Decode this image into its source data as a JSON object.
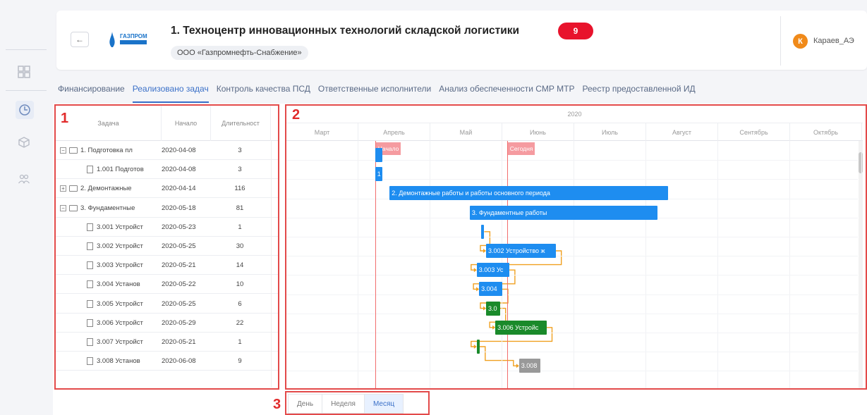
{
  "header": {
    "back_label": "←",
    "logo_text": "ГАЗПРОМ",
    "title": "1. Техноцентр инновационных технологий складской логистики",
    "badge_count": "9",
    "org": "ООО «Газпромнефть-Снабжение»",
    "avatar_letter": "К",
    "username": "Караев_АЭ"
  },
  "tabs": [
    {
      "label": "Финансирование",
      "active": false
    },
    {
      "label": "Реализовано задач",
      "active": true
    },
    {
      "label": "Контроль качества ПСД",
      "active": false
    },
    {
      "label": "Ответственные исполнители",
      "active": false
    },
    {
      "label": "Анализ обеспеченности СМР МТР",
      "active": false
    },
    {
      "label": "Реестр предоставленной ИД",
      "active": false
    }
  ],
  "grid": {
    "columns": [
      "Задача",
      "Начало",
      "Длительност"
    ],
    "rows": [
      {
        "level": 0,
        "kind": "folder-open",
        "toggle": "−",
        "task": "1. Подготовка пл",
        "start": "2020-04-08",
        "duration": "3"
      },
      {
        "level": 1,
        "kind": "file",
        "task": "1.001 Подготов",
        "start": "2020-04-08",
        "duration": "3"
      },
      {
        "level": 0,
        "kind": "folder",
        "toggle": "+",
        "task": "2. Демонтажные",
        "start": "2020-04-14",
        "duration": "116"
      },
      {
        "level": 0,
        "kind": "folder-open",
        "toggle": "−",
        "task": "3. Фундаментные",
        "start": "2020-05-18",
        "duration": "81"
      },
      {
        "level": 1,
        "kind": "file",
        "task": "3.001 Устройст",
        "start": "2020-05-23",
        "duration": "1"
      },
      {
        "level": 1,
        "kind": "file",
        "task": "3.002 Устройст",
        "start": "2020-05-25",
        "duration": "30"
      },
      {
        "level": 1,
        "kind": "file",
        "task": "3.003 Устройст",
        "start": "2020-05-21",
        "duration": "14"
      },
      {
        "level": 1,
        "kind": "file",
        "task": "3.004 Установ",
        "start": "2020-05-22",
        "duration": "10"
      },
      {
        "level": 1,
        "kind": "file",
        "task": "3.005 Устройст",
        "start": "2020-05-25",
        "duration": "6"
      },
      {
        "level": 1,
        "kind": "file",
        "task": "3.006 Устройст",
        "start": "2020-05-29",
        "duration": "22"
      },
      {
        "level": 1,
        "kind": "file",
        "task": "3.007 Устройст",
        "start": "2020-05-21",
        "duration": "1"
      },
      {
        "level": 1,
        "kind": "file",
        "task": "3.008 Установ",
        "start": "2020-06-08",
        "duration": "9"
      }
    ]
  },
  "gantt": {
    "year": "2020",
    "months": [
      "Март",
      "Апрель",
      "Май",
      "Июнь",
      "Июль",
      "Август",
      "Сентябрь",
      "Октябрь"
    ],
    "markers": [
      {
        "label": "Начало",
        "date": "2020-04-08"
      },
      {
        "label": "Сегодня",
        "date": "2020-06-03"
      }
    ],
    "bars": [
      {
        "row": 0,
        "label": "",
        "start": "2020-04-08",
        "days": 3,
        "color": "blue"
      },
      {
        "row": 1,
        "label": "1",
        "start": "2020-04-08",
        "days": 3,
        "color": "blue"
      },
      {
        "row": 2,
        "label": "2. Демонтажные работы и работы основного периода",
        "start": "2020-04-14",
        "days": 116,
        "color": "blue"
      },
      {
        "row": 3,
        "label": "3. Фундаментные работы",
        "start": "2020-05-18",
        "days": 81,
        "color": "blue"
      },
      {
        "row": 4,
        "label": "",
        "start": "2020-05-23",
        "days": 1,
        "color": "blue"
      },
      {
        "row": 5,
        "label": "3.002 Устройство ж",
        "start": "2020-05-25",
        "days": 30,
        "color": "blue"
      },
      {
        "row": 6,
        "label": "3.003 Ус",
        "start": "2020-05-21",
        "days": 14,
        "color": "blue"
      },
      {
        "row": 7,
        "label": "3.004",
        "start": "2020-05-22",
        "days": 10,
        "color": "blue"
      },
      {
        "row": 8,
        "label": "3.0",
        "start": "2020-05-25",
        "days": 6,
        "color": "green"
      },
      {
        "row": 9,
        "label": "3.006 Устройс",
        "start": "2020-05-29",
        "days": 22,
        "color": "green"
      },
      {
        "row": 10,
        "label": "",
        "start": "2020-05-21",
        "days": 1,
        "color": "green"
      },
      {
        "row": 11,
        "label": "3.008",
        "start": "2020-06-08",
        "days": 9,
        "color": "grey"
      }
    ]
  },
  "scale": [
    {
      "label": "День",
      "active": false
    },
    {
      "label": "Неделя",
      "active": false
    },
    {
      "label": "Месяц",
      "active": true
    }
  ],
  "callouts": [
    "1",
    "2",
    "3"
  ],
  "colors": {
    "accent": "#3a70c8",
    "badge": "#e8132c",
    "bar": "#1e8df0",
    "bar_green": "#1a8a2a",
    "marker": "#f26d6d",
    "callout": "#e34a4a",
    "link": "#f0a020"
  }
}
